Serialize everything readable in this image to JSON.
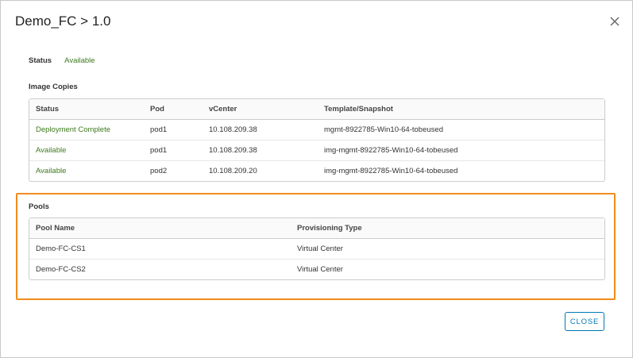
{
  "dialog": {
    "title": "Demo_FC > 1.0",
    "close_icon": "close-icon"
  },
  "status": {
    "label": "Status",
    "value": "Available"
  },
  "image_copies": {
    "heading": "Image Copies",
    "columns": [
      "Status",
      "Pod",
      "vCenter",
      "Template/Snapshot"
    ],
    "rows": [
      [
        "Deployment Complete",
        "pod1",
        "10.108.209.38",
        "mgmt-8922785-Win10-64-tobeused"
      ],
      [
        "Available",
        "pod1",
        "10.108.209.38",
        "img-mgmt-8922785-Win10-64-tobeused"
      ],
      [
        "Available",
        "pod2",
        "10.108.209.20",
        "img-mgmt-8922785-Win10-64-tobeused"
      ]
    ]
  },
  "pools": {
    "heading": "Pools",
    "columns": [
      "Pool Name",
      "Provisioning Type"
    ],
    "rows": [
      [
        "Demo-FC-CS1",
        "Virtual Center"
      ],
      [
        "Demo-FC-CS2",
        "Virtual Center"
      ]
    ]
  },
  "footer": {
    "close_label": "CLOSE"
  },
  "colors": {
    "status_green": "#3d7a1d",
    "highlight_orange": "#f08c1e",
    "button_blue": "#0079b8"
  }
}
